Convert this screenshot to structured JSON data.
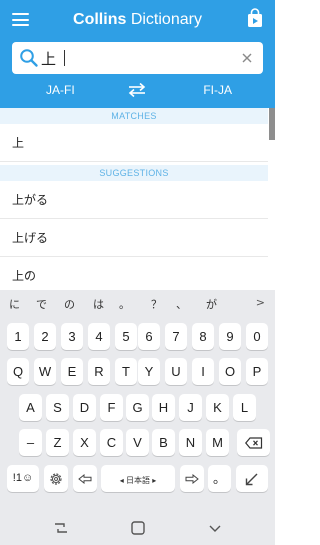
{
  "header": {
    "title_bold": "Collins",
    "title_rest": " Dictionary",
    "menu_icon": "hamburger-menu-icon",
    "store_icon": "shopping-bag-icon",
    "accent": "#2f9fe5"
  },
  "search": {
    "value": "上",
    "placeholder": ""
  },
  "languages": {
    "left": "JA-FI",
    "right": "FI-JA"
  },
  "results": {
    "matches_header": "MATCHES",
    "matches": [
      "上"
    ],
    "suggestions_header": "SUGGESTIONS",
    "suggestions": [
      "上がる",
      "上げる",
      "上の"
    ]
  },
  "keyboard": {
    "suggestions": [
      "に",
      "で",
      "の",
      "は",
      "。",
      "？",
      "、",
      "が"
    ],
    "more_arrow": ">",
    "row_numbers": [
      "1",
      "2",
      "3",
      "4",
      "5",
      "6",
      "7",
      "8",
      "9",
      "0"
    ],
    "row_q": [
      "Q",
      "W",
      "E",
      "R",
      "T",
      "Y",
      "U",
      "I",
      "O",
      "P"
    ],
    "row_a": [
      "A",
      "S",
      "D",
      "F",
      "G",
      "H",
      "J",
      "K",
      "L"
    ],
    "row_z": [
      "–",
      "Z",
      "X",
      "C",
      "V",
      "B",
      "N",
      "M"
    ],
    "symbols_key": "!1☺",
    "space_label": "◂  日本語  ▸",
    "period_key": "。",
    "comma_key": "、"
  }
}
